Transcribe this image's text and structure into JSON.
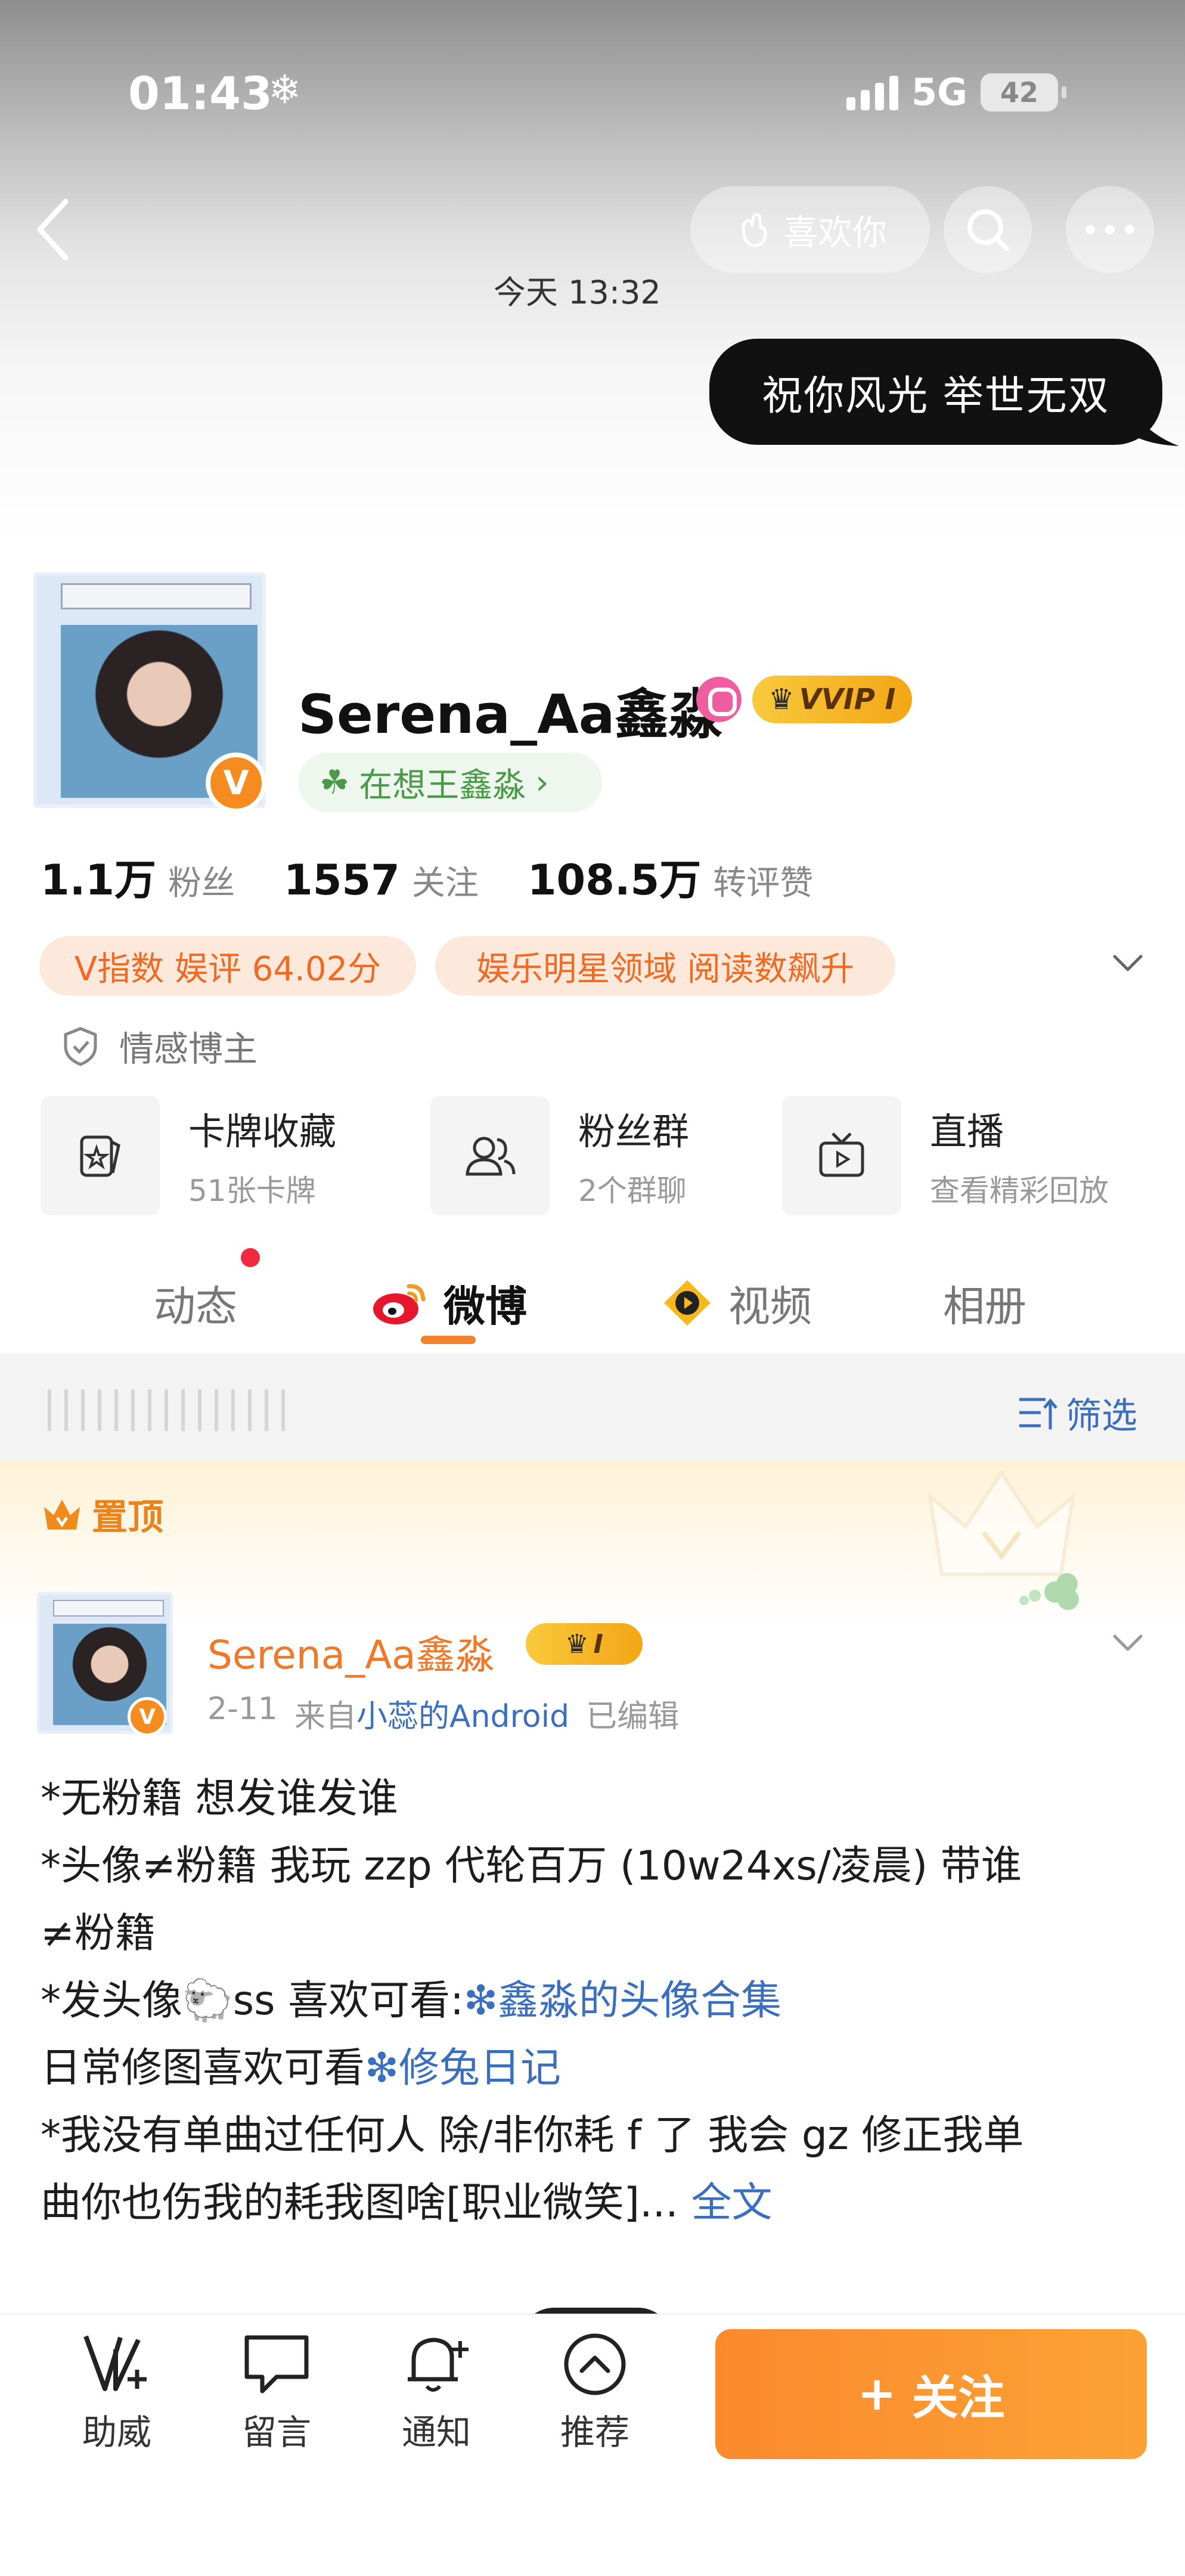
{
  "status_bar": {
    "time": "01:43",
    "network": "5G",
    "battery": "42"
  },
  "header": {
    "like_label": "喜欢你",
    "timestamp": "今天 13:32",
    "message": "祝你风光  举世无双"
  },
  "profile": {
    "name": "Serena_Aa鑫淼",
    "vip_label": "VVIP I",
    "status": "在想王鑫淼",
    "stats": [
      {
        "value": "1.1万",
        "label": "粉丝"
      },
      {
        "value": "1557",
        "label": "关注"
      },
      {
        "value": "108.5万",
        "label": "转评赞"
      }
    ],
    "tags": [
      "V指数 娱评 64.02分",
      "娱乐明星领域 阅读数飙升"
    ],
    "category": "情感博主"
  },
  "quick_links": [
    {
      "title": "卡牌收藏",
      "subtitle": "51张卡牌",
      "icon": "card-icon"
    },
    {
      "title": "粉丝群",
      "subtitle": "2个群聊",
      "icon": "group-icon"
    },
    {
      "title": "直播",
      "subtitle": "查看精彩回放",
      "icon": "tv-icon"
    }
  ],
  "tabs": [
    "动态",
    "微博",
    "视频",
    "相册"
  ],
  "filter_label": "筛选",
  "pinned_label": "置顶",
  "post": {
    "author": "Serena_Aa鑫淼",
    "badge": "I",
    "date": "2-11",
    "source_prefix": "来自",
    "source": "小蕊的Android",
    "edited": "已编辑",
    "line1": "*无粉籍 想发谁发谁",
    "line2": "*头像≠粉籍 我玩 zzp 代轮百万 (10w24xs/凌晨) 带谁",
    "line3": "≠粉籍",
    "line4_pre": "*发头像",
    "line4_mid": "ss 喜欢可看:",
    "line4_link": "鑫淼的头像合集",
    "line5_pre": "日常修图喜欢可看",
    "line5_link": "修兔日记",
    "line6": "*我没有单曲过任何人 除/非你耗 f 了 我会 gz 修正我单",
    "line7": "曲你也伤我的耗我图啥[职业微笑]... ",
    "more_link": "全文"
  },
  "bottom_bar": {
    "items": [
      "助威",
      "留言",
      "通知",
      "推荐"
    ],
    "follow_label": "关注"
  },
  "colors": {
    "accent": "#f2822d",
    "link": "#3a6fc0",
    "follow": "#fb8a2d"
  }
}
